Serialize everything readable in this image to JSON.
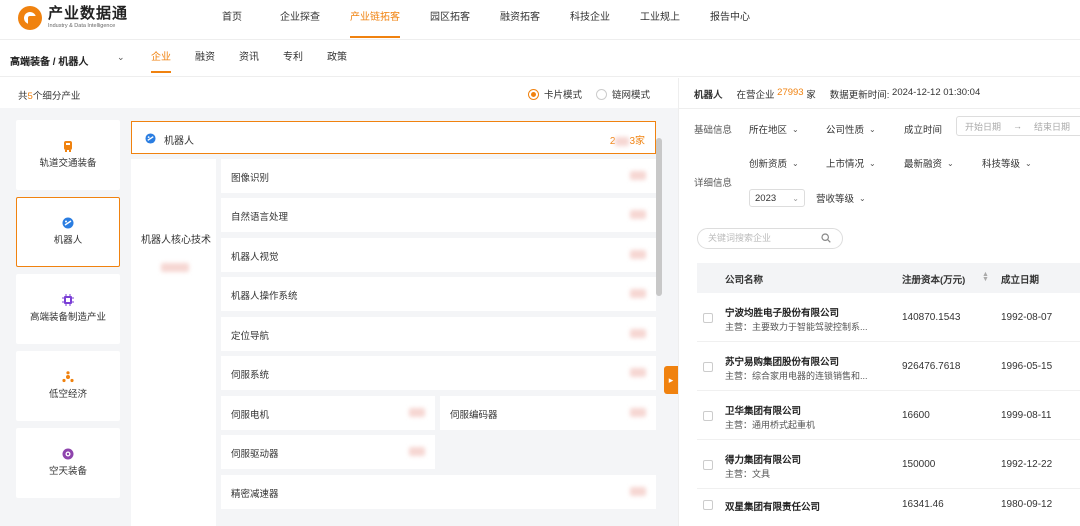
{
  "brand": {
    "title": "产业数据通",
    "subtitle": "Industry & Data Intelligence"
  },
  "nav": [
    "首页",
    "企业探查",
    "产业链拓客",
    "园区拓客",
    "融资拓客",
    "科技企业",
    "工业规上",
    "报告中心"
  ],
  "nav_active_index": 2,
  "breadcrumb": "高端装备 / 机器人",
  "subtabs": [
    "企业",
    "融资",
    "资讯",
    "专利",
    "政策"
  ],
  "subtab_active_index": 0,
  "count": {
    "prefix": "共",
    "num": "5",
    "suffix": "个细分产业"
  },
  "modes": {
    "card": "卡片模式",
    "chain": "链网模式"
  },
  "categories": [
    "轨道交通装备",
    "机器人",
    "高端装备制造产业",
    "低空经济",
    "空天装备"
  ],
  "category_active_index": 1,
  "tree": {
    "root_label": "机器人",
    "root_count_prefix": "2",
    "root_count_suffix": "3家",
    "group_label": "机器人核心技术",
    "nodes": [
      "图像识别",
      "自然语言处理",
      "机器人视觉",
      "机器人操作系统",
      "定位导航",
      "伺服系统",
      "伺服电机",
      "伺服编码器",
      "伺服驱动器",
      "精密减速器"
    ]
  },
  "right": {
    "title": "机器人",
    "active_label": "在营企业",
    "active_count": "27993",
    "unit": "家",
    "update_label": "数据更新时间:",
    "update_time": "2024-12-12 01:30:04",
    "basic_info": "基础信息",
    "detail_info": "详细信息",
    "basic_filters": [
      "所在地区",
      "公司性质"
    ],
    "founded_label": "成立时间",
    "date_start": "开始日期",
    "date_end": "结束日期",
    "detail_filters": [
      "创新资质",
      "上市情况",
      "最新融资",
      "科技等级"
    ],
    "year": "2023",
    "revenue_filter": "营收等级",
    "search_placeholder": "关键词搜索企业",
    "columns": [
      "公司名称",
      "注册资本(万元)",
      "成立日期"
    ],
    "biz_prefix": "主营：",
    "companies": [
      {
        "name": "宁波均胜电子股份有限公司",
        "biz": "主要致力于智能驾驶控制系...",
        "capital": "140870.1543",
        "date": "1992-08-07"
      },
      {
        "name": "苏宁易购集团股份有限公司",
        "biz": "综合家用电器的连锁销售和...",
        "capital": "926476.7618",
        "date": "1996-05-15"
      },
      {
        "name": "卫华集团有限公司",
        "biz": "通用桥式起重机",
        "capital": "16600",
        "date": "1999-08-11"
      },
      {
        "name": "得力集团有限公司",
        "biz": "文具",
        "capital": "150000",
        "date": "1992-12-22"
      },
      {
        "name": "双星集团有限责任公司",
        "biz": "",
        "capital": "16341.46",
        "date": "1980-09-12"
      }
    ]
  }
}
